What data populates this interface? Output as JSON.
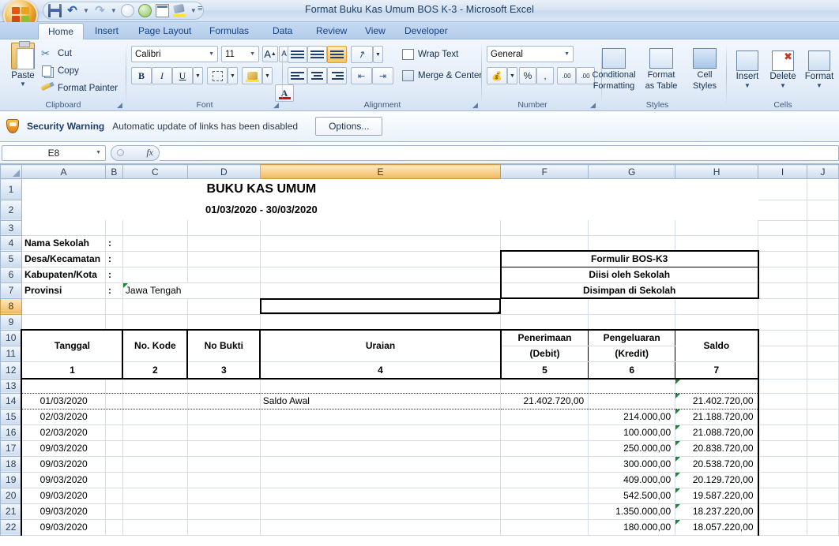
{
  "window": {
    "title": "Format Buku Kas Umum BOS K-3 - Microsoft Excel"
  },
  "quick_access": {
    "items": [
      {
        "name": "save-icon",
        "label": "Save"
      },
      {
        "name": "undo-icon",
        "label": "Undo"
      },
      {
        "name": "redo-icon",
        "label": "Redo"
      },
      {
        "name": "open-icon",
        "label": "Open"
      },
      {
        "name": "refresh-icon",
        "label": "Refresh"
      },
      {
        "name": "print-preview-icon",
        "label": "Print Preview"
      },
      {
        "name": "fill-color-icon",
        "label": "Fill Color"
      }
    ],
    "customize_label": "☰"
  },
  "ribbon": {
    "tabs": [
      {
        "label": "Home",
        "active": true
      },
      {
        "label": "Insert",
        "active": false
      },
      {
        "label": "Page Layout",
        "active": false
      },
      {
        "label": "Formulas",
        "active": false
      },
      {
        "label": "Data",
        "active": false
      },
      {
        "label": "Review",
        "active": false
      },
      {
        "label": "View",
        "active": false
      },
      {
        "label": "Developer",
        "active": false
      }
    ],
    "clipboard": {
      "group_label": "Clipboard",
      "paste_label": "Paste",
      "cut_label": "Cut",
      "copy_label": "Copy",
      "format_painter_label": "Format Painter"
    },
    "font": {
      "group_label": "Font",
      "font_name": "Calibri",
      "font_size": "11",
      "grow_label": "A",
      "shrink_label": "A",
      "bold_label": "B",
      "italic_label": "I",
      "underline_label": "U"
    },
    "alignment": {
      "group_label": "Alignment",
      "wrap_text_label": "Wrap Text",
      "merge_center_label": "Merge & Center"
    },
    "number": {
      "group_label": "Number",
      "format_value": "General",
      "percent_label": "%",
      "comma_label": ",",
      "inc_dec_label": ".00",
      "dec_dec_label": ".00"
    },
    "styles": {
      "group_label": "Styles",
      "conditional_formatting_label": "Conditional\nFormatting",
      "conditional_formatting_l1": "Conditional",
      "conditional_formatting_l2": "Formatting",
      "format_as_table_l1": "Format",
      "format_as_table_l2": "as Table",
      "cell_styles_l1": "Cell",
      "cell_styles_l2": "Styles"
    },
    "cells": {
      "group_label": "Cells",
      "insert_label": "Insert",
      "delete_label": "Delete",
      "format_label": "Format"
    }
  },
  "security_bar": {
    "title": "Security Warning",
    "message": "Automatic update of links has been disabled",
    "options_label": "Options..."
  },
  "formula_bar": {
    "name_box": "E8",
    "fx_label": "fx",
    "formula_value": ""
  },
  "grid": {
    "columns": [
      "A",
      "B",
      "C",
      "D",
      "E",
      "F",
      "G",
      "H",
      "I",
      "J"
    ],
    "selected_column": "E",
    "selected_row": "8",
    "selected_cell": "E8",
    "rows": [
      "1",
      "2",
      "3",
      "4",
      "5",
      "6",
      "7",
      "8",
      "9",
      "10",
      "11",
      "12",
      "13",
      "14",
      "15",
      "16",
      "17",
      "18",
      "19",
      "20",
      "21",
      "22"
    ]
  },
  "sheet": {
    "title": "BUKU KAS UMUM",
    "subtitle": "01/03/2020 - 30/03/2020",
    "info_labels": [
      {
        "label": "Nama Sekolah",
        "colon": ":",
        "value": ""
      },
      {
        "label": "Desa/Kecamatan",
        "colon": ":",
        "value": ""
      },
      {
        "label": "Kabupaten/Kota",
        "colon": ":",
        "value": ""
      },
      {
        "label": "Provinsi",
        "colon": ":",
        "value": "Jawa Tengah"
      }
    ],
    "formulir_box": [
      "Formulir BOS-K3",
      "Diisi oleh Sekolah",
      "Disimpan di Sekolah"
    ],
    "table_headers": [
      "Tanggal",
      "No. Kode",
      "No Bukti",
      "Uraian",
      "Penerimaan",
      "(Debit)",
      "Pengeluaran",
      "(Kredit)",
      "Saldo"
    ],
    "header_numbers": [
      "1",
      "2",
      "3",
      "4",
      "5",
      "6",
      "7"
    ],
    "data_rows": [
      {
        "row": "14",
        "tanggal": "01/03/2020",
        "kode": "",
        "bukti": "",
        "uraian": "Saldo Awal",
        "penerimaan": "21.402.720,00",
        "pengeluaran": "",
        "saldo": "21.402.720,00"
      },
      {
        "row": "15",
        "tanggal": "02/03/2020",
        "kode": "",
        "bukti": "",
        "uraian": "",
        "penerimaan": "",
        "pengeluaran": "214.000,00",
        "saldo": "21.188.720,00"
      },
      {
        "row": "16",
        "tanggal": "02/03/2020",
        "kode": "",
        "bukti": "",
        "uraian": "",
        "penerimaan": "",
        "pengeluaran": "100.000,00",
        "saldo": "21.088.720,00"
      },
      {
        "row": "17",
        "tanggal": "09/03/2020",
        "kode": "",
        "bukti": "",
        "uraian": "",
        "penerimaan": "",
        "pengeluaran": "250.000,00",
        "saldo": "20.838.720,00"
      },
      {
        "row": "18",
        "tanggal": "09/03/2020",
        "kode": "",
        "bukti": "",
        "uraian": "",
        "penerimaan": "",
        "pengeluaran": "300.000,00",
        "saldo": "20.538.720,00"
      },
      {
        "row": "19",
        "tanggal": "09/03/2020",
        "kode": "",
        "bukti": "",
        "uraian": "",
        "penerimaan": "",
        "pengeluaran": "409.000,00",
        "saldo": "20.129.720,00"
      },
      {
        "row": "20",
        "tanggal": "09/03/2020",
        "kode": "",
        "bukti": "",
        "uraian": "",
        "penerimaan": "",
        "pengeluaran": "542.500,00",
        "saldo": "19.587.220,00"
      },
      {
        "row": "21",
        "tanggal": "09/03/2020",
        "kode": "",
        "bukti": "",
        "uraian": "",
        "penerimaan": "",
        "pengeluaran": "1.350.000,00",
        "saldo": "18.237.220,00"
      },
      {
        "row": "22",
        "tanggal": "09/03/2020",
        "kode": "",
        "bukti": "",
        "uraian": "",
        "penerimaan": "",
        "pengeluaran": "180.000,00",
        "saldo": "18.057.220,00"
      }
    ]
  },
  "colors": {
    "ribbon_blue": "#c5d9f1",
    "selection_orange": "#f8cf8c",
    "title_text": "#1c3f66",
    "error_triangle": "#128a2d"
  }
}
